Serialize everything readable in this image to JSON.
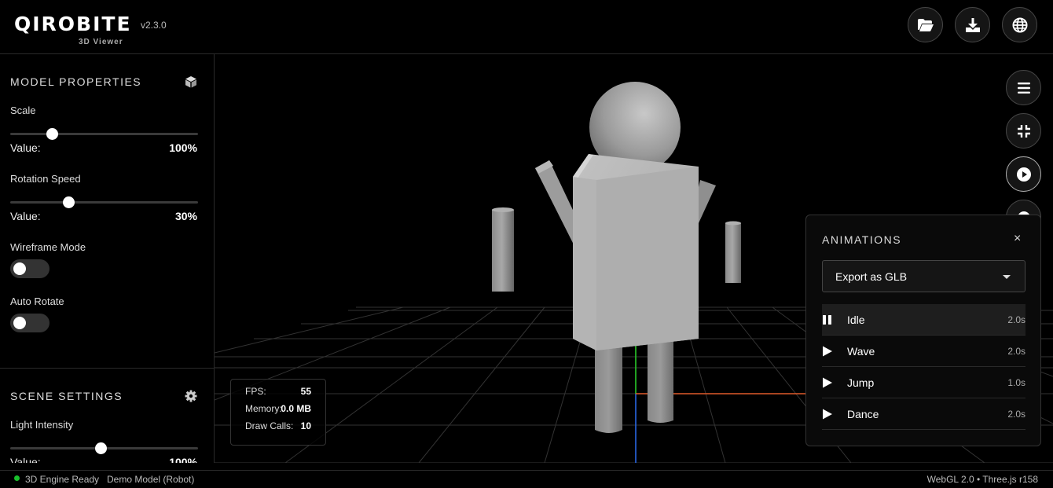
{
  "app": {
    "name": "QIROBITE",
    "subtitle": "3D Viewer",
    "version": "v2.3.0"
  },
  "header_buttons": [
    {
      "icon": "folder-open-icon",
      "name": "open-file-button"
    },
    {
      "icon": "download-icon",
      "name": "download-button"
    },
    {
      "icon": "globe-icon",
      "name": "language-button"
    }
  ],
  "model_properties": {
    "title": "MODEL PROPERTIES",
    "icon": "cube-icon",
    "scale": {
      "label": "Scale",
      "value_label": "Value:",
      "value": "100%",
      "fraction": 0.22
    },
    "rotation_speed": {
      "label": "Rotation Speed",
      "value_label": "Value:",
      "value": "30%",
      "fraction": 0.31
    },
    "wireframe": {
      "label": "Wireframe Mode",
      "on": false
    },
    "auto_rotate": {
      "label": "Auto Rotate",
      "on": false
    }
  },
  "scene_settings": {
    "title": "SCENE SETTINGS",
    "icon": "gear-icon",
    "light_intensity": {
      "label": "Light Intensity",
      "value_label": "Value:",
      "value": "100%",
      "fraction": 0.48
    }
  },
  "stats": {
    "fps_label": "FPS:",
    "fps": "55",
    "memory_label": "Memory:",
    "memory": "0.0 MB",
    "draw_calls_label": "Draw Calls:",
    "draw_calls": "10"
  },
  "viewport_buttons": [
    {
      "icon": "menu-icon",
      "name": "menu-button"
    },
    {
      "icon": "compress-icon",
      "name": "compress-button"
    },
    {
      "icon": "play-circle-icon",
      "name": "animations-button"
    }
  ],
  "animations": {
    "title": "ANIMATIONS",
    "close": "×",
    "export_select": "Export as GLB",
    "items": [
      {
        "name": "Idle",
        "duration": "2.0s",
        "playing": true
      },
      {
        "name": "Wave",
        "duration": "2.0s",
        "playing": false
      },
      {
        "name": "Jump",
        "duration": "1.0s",
        "playing": false
      },
      {
        "name": "Dance",
        "duration": "2.0s",
        "playing": false
      }
    ]
  },
  "footer": {
    "status": "3D Engine Ready",
    "model": "Demo Model (Robot)",
    "engine": "WebGL 2.0 • Three.js r158"
  },
  "colors": {
    "status_ready": "#19c12c",
    "axis_x": "#e05a2a",
    "axis_y": "#2bd62b",
    "axis_z": "#2a6cf0"
  }
}
